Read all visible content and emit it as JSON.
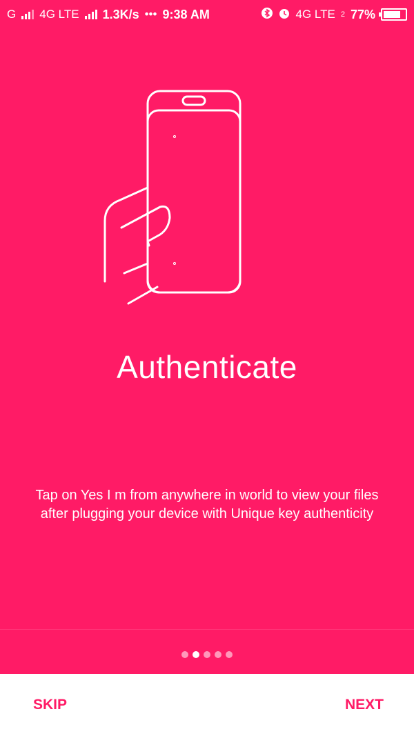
{
  "status_bar": {
    "carrier1": "G",
    "network": "4G LTE",
    "speed": "1.3K/s",
    "more": "•••",
    "time": "9:38 AM",
    "network2": "4G LTE",
    "sim2_index": "2",
    "battery_percent": "77%"
  },
  "onboarding": {
    "title": "Authenticate",
    "description": "Tap on Yes I m from anywhere in world to view your files after plugging your device with Unique key authenticity",
    "total_pages": 5,
    "current_page": 2
  },
  "actions": {
    "skip_label": "SKIP",
    "next_label": "NEXT"
  },
  "colors": {
    "background": "#ff1b66",
    "accent": "#ff1b66",
    "bottom_bar": "#ffffff"
  }
}
